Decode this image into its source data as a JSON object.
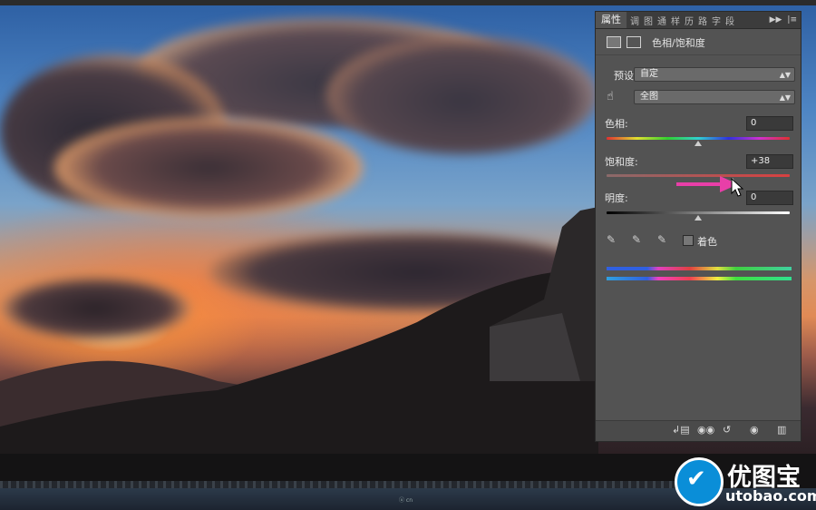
{
  "panel": {
    "tabs": [
      "属性",
      "调",
      "图",
      "通",
      "样",
      "历",
      "路",
      "字",
      "段"
    ],
    "title": "色相/饱和度",
    "preset_label": "预设:",
    "preset_value": "自定",
    "channel_value": "全图",
    "hue": {
      "label": "色相:",
      "value": "0",
      "level": 0.5
    },
    "saturation": {
      "label": "饱和度:",
      "value": "+38",
      "level": 0.69
    },
    "lightness": {
      "label": "明度:",
      "value": "0",
      "level": 0.5
    },
    "colorize_label": "着色"
  },
  "watermark": {
    "brand": "优图宝",
    "url": "utobao.com",
    "tiny": "ⓤ cn"
  },
  "colors": {
    "panel_bg": "#535353",
    "arrow": "#e83fa8",
    "logo": "#0a8ed8"
  }
}
